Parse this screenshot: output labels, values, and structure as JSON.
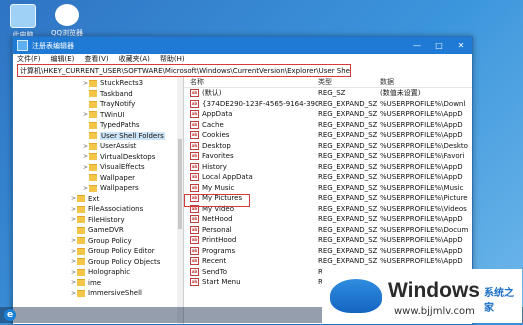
{
  "desktop": {
    "icons": [
      {
        "label": "此电脑"
      },
      {
        "label": "QQ浏览器"
      }
    ]
  },
  "window": {
    "title": "注册表编辑器",
    "controls": {
      "minimize": "—",
      "maximize": "□",
      "close": "✕"
    }
  },
  "menu": [
    "文件(F)",
    "编辑(E)",
    "查看(V)",
    "收藏夹(A)",
    "帮助(H)"
  ],
  "address": "计算机\\HKEY_CURRENT_USER\\SOFTWARE\\Microsoft\\Windows\\CurrentVersion\\Explorer\\User Shell Folders",
  "tree": [
    {
      "label": "StuckRects3",
      "arrow": ">"
    },
    {
      "label": "Taskband",
      "arrow": ""
    },
    {
      "label": "TrayNotify",
      "arrow": ""
    },
    {
      "label": "TWinUI",
      "arrow": ">"
    },
    {
      "label": "TypedPaths",
      "arrow": ""
    },
    {
      "label": "User Shell Folders",
      "arrow": "",
      "selected": true
    },
    {
      "label": "UserAssist",
      "arrow": ">"
    },
    {
      "label": "VirtualDesktops",
      "arrow": ">"
    },
    {
      "label": "VisualEffects",
      "arrow": ">"
    },
    {
      "label": "Wallpaper",
      "arrow": ""
    },
    {
      "label": "Wallpapers",
      "arrow": ">"
    },
    {
      "label": "Ext",
      "arrow": ">"
    },
    {
      "label": "FileAssociations",
      "arrow": ">"
    },
    {
      "label": "FileHistory",
      "arrow": ">"
    },
    {
      "label": "GameDVR",
      "arrow": ""
    },
    {
      "label": "Group Policy",
      "arrow": ">"
    },
    {
      "label": "Group Policy Editor",
      "arrow": ">"
    },
    {
      "label": "Group Policy Objects",
      "arrow": ">"
    },
    {
      "label": "Holographic",
      "arrow": ">"
    },
    {
      "label": "ime",
      "arrow": ">"
    },
    {
      "label": "ImmersiveShell",
      "arrow": ">"
    }
  ],
  "list": {
    "headers": [
      "名称",
      "类型",
      "数据"
    ],
    "rows": [
      {
        "name": "(默认)",
        "type": "REG_SZ",
        "data": "(数值未设置)"
      },
      {
        "name": "{374DE290-123F-4565-9164-39C4925...",
        "type": "REG_EXPAND_SZ",
        "data": "%USERPROFILE%\\Downl"
      },
      {
        "name": "AppData",
        "type": "REG_EXPAND_SZ",
        "data": "%USERPROFILE%\\AppD"
      },
      {
        "name": "Cache",
        "type": "REG_EXPAND_SZ",
        "data": "%USERPROFILE%\\AppD"
      },
      {
        "name": "Cookies",
        "type": "REG_EXPAND_SZ",
        "data": "%USERPROFILE%\\AppD"
      },
      {
        "name": "Desktop",
        "type": "REG_EXPAND_SZ",
        "data": "%USERPROFILE%\\Deskto"
      },
      {
        "name": "Favorites",
        "type": "REG_EXPAND_SZ",
        "data": "%USERPROFILE%\\Favori"
      },
      {
        "name": "History",
        "type": "REG_EXPAND_SZ",
        "data": "%USERPROFILE%\\AppD"
      },
      {
        "name": "Local AppData",
        "type": "REG_EXPAND_SZ",
        "data": "%USERPROFILE%\\AppD"
      },
      {
        "name": "My Music",
        "type": "REG_EXPAND_SZ",
        "data": "%USERPROFILE%\\Music"
      },
      {
        "name": "My Pictures",
        "type": "REG_EXPAND_SZ",
        "data": "%USERPROFILE%\\Picture"
      },
      {
        "name": "My Video",
        "type": "REG_EXPAND_SZ",
        "data": "%USERPROFILE%\\Videos"
      },
      {
        "name": "NetHood",
        "type": "REG_EXPAND_SZ",
        "data": "%USERPROFILE%\\AppD"
      },
      {
        "name": "Personal",
        "type": "REG_EXPAND_SZ",
        "data": "%USERPROFILE%\\Docum"
      },
      {
        "name": "PrintHood",
        "type": "REG_EXPAND_SZ",
        "data": "%USERPROFILE%\\AppD"
      },
      {
        "name": "Programs",
        "type": "REG_EXPAND_SZ",
        "data": "%USERPROFILE%\\AppD"
      },
      {
        "name": "Recent",
        "type": "REG_EXPAND_SZ",
        "data": "%USERPROFILE%\\AppD"
      },
      {
        "name": "SendTo",
        "type": "REG_EXPAND_SZ",
        "data": "%USERPROFILE%\\AppD"
      },
      {
        "name": "Start Menu",
        "type": "REG_EXPAND_SZ",
        "data": "%USERPROFILE%\\AppD"
      }
    ]
  },
  "watermark": {
    "brand": "Windows",
    "cn": "系统之家",
    "url": "www.bjjmlv.com"
  },
  "taskbar": {
    "edge_glyph": "e"
  },
  "icons": {
    "string_value": "ab",
    "folder": "folder-icon"
  }
}
